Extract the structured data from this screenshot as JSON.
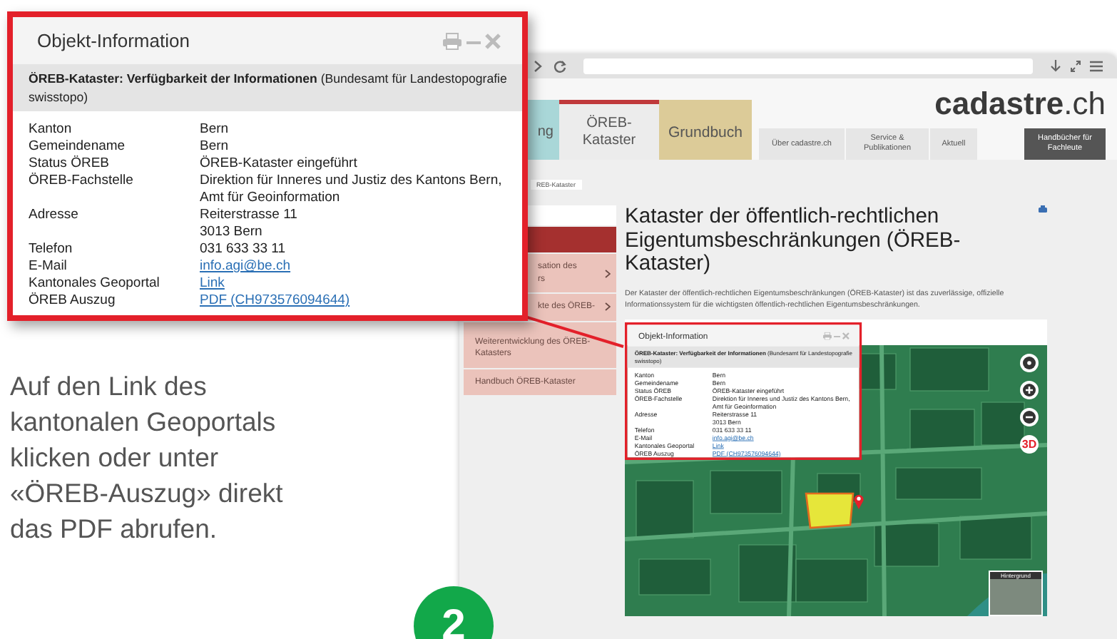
{
  "popup": {
    "title": "Objekt-Information",
    "heading": "**ÖREB-Kataster: Verfügbarkeit der Informationen** (Bundesamt für Landestopografie swisstopo)",
    "rows": [
      {
        "label": "Kanton",
        "kind": "text",
        "lines": [
          "Bern"
        ]
      },
      {
        "label": "Gemeindename",
        "kind": "text",
        "lines": [
          "Bern"
        ]
      },
      {
        "label": "Status ÖREB",
        "kind": "text",
        "lines": [
          "ÖREB-Kataster eingeführt"
        ]
      },
      {
        "label": "ÖREB-Fachstelle",
        "kind": "text",
        "lines": [
          "Direktion für Inneres und Justiz des Kantons Bern,",
          "Amt für Geoinformation"
        ]
      },
      {
        "label": "Adresse",
        "kind": "text",
        "lines": [
          "Reiterstrasse 11",
          "3013 Bern"
        ]
      },
      {
        "label": "Telefon",
        "kind": "text",
        "lines": [
          "031 633 33 11"
        ]
      },
      {
        "label": "E-Mail",
        "kind": "link",
        "lines": [
          "info.agi@be.ch"
        ]
      },
      {
        "label": "Kantonales Geoportal",
        "kind": "link",
        "lines": [
          "Link"
        ]
      },
      {
        "label": "ÖREB Auszug",
        "kind": "link",
        "lines": [
          "PDF (CH973576094644)"
        ]
      }
    ]
  },
  "instruction": "Auf den Link des kantonalen Geoportals klicken oder unter «ÖREB-Auszug» direkt das PDF abrufen.",
  "step": "2",
  "site": {
    "logo": "**cadastre**.ch",
    "main_tabs": [
      {
        "label": "ng",
        "color": "#a9d7d8",
        "selected": false
      },
      {
        "label": "ÖREB-Kataster",
        "color": "#ececec",
        "selected": true
      },
      {
        "label": "Grundbuch",
        "color": "#dccb98",
        "selected": false
      }
    ],
    "sub_tabs": [
      {
        "label": "Über cadastre.ch"
      },
      {
        "label": "Service & Publikationen"
      },
      {
        "label": "Aktuell"
      }
    ],
    "manuals_button": "Handbücher für Fachleute",
    "breadcrumb": "REB-Kataster",
    "sidebar": [
      {
        "lines": [
          "sation des",
          "rs"
        ],
        "has_submenu": true
      },
      {
        "lines": [
          "kte des ÖREB-"
        ],
        "has_submenu": true
      },
      {
        "lines": [
          "Weiterentwicklung des ÖREB-Katasters"
        ],
        "has_submenu": false
      },
      {
        "lines": [
          "Handbuch ÖREB-Kataster"
        ],
        "has_submenu": false
      }
    ],
    "title": "Kataster der öffentlich-rechtlichen Eigentumsbeschränkungen (ÖREB-Kataster)",
    "intro": "Der Kataster der öffentlich-rechtlichen Eigentumsbeschränkungen (ÖREB-Kataster) ist das zuverlässige, offizielle Informationssystem für die wichtigsten öffentlich-rechtlichen Eigentumsbeschränkungen.",
    "map": {
      "button_3d": "3D",
      "background_label": "Hintergrund"
    }
  },
  "map_popup": {
    "title": "Objekt-Information",
    "heading": "**ÖREB-Kataster: Verfügbarkeit der Informationen** (Bundesamt für Landestopografie swisstopo)",
    "rows": [
      {
        "label": "Kanton",
        "kind": "text",
        "lines": [
          "Bern"
        ]
      },
      {
        "label": "Gemeindename",
        "kind": "text",
        "lines": [
          "Bern"
        ]
      },
      {
        "label": "Status ÖREB",
        "kind": "text",
        "lines": [
          "ÖREB-Kataster eingeführt"
        ]
      },
      {
        "label": "ÖREB-Fachstelle",
        "kind": "text",
        "lines": [
          "Direktion für Inneres und Justiz des Kantons Bern,",
          "Amt für Geoinformation"
        ]
      },
      {
        "label": "Adresse",
        "kind": "text",
        "lines": [
          "Reiterstrasse 11",
          "3013 Bern"
        ]
      },
      {
        "label": "Telefon",
        "kind": "text",
        "lines": [
          "031 633 33 11"
        ]
      },
      {
        "label": "E-Mail",
        "kind": "link",
        "lines": [
          "info.agi@be.ch"
        ]
      },
      {
        "label": "Kantonales Geoportal",
        "kind": "link",
        "lines": [
          "Link"
        ]
      },
      {
        "label": "ÖREB Auszug",
        "kind": "link",
        "lines": [
          "PDF (CH973576094644)"
        ]
      }
    ]
  }
}
